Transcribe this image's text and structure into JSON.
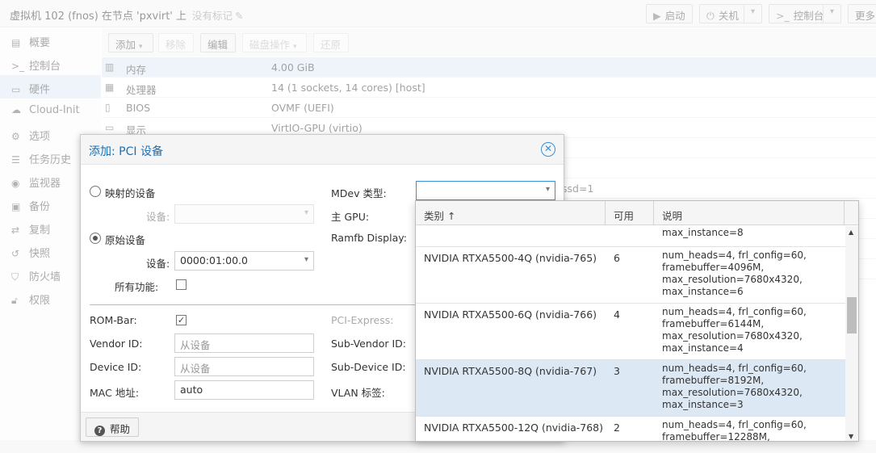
{
  "titlebar": {
    "title": "虚拟机 102 (fnos) 在节点 'pxvirt' 上",
    "no_tags": "没有标记",
    "start": "启动",
    "shutdown": "关机",
    "console": "控制台",
    "more": "更多"
  },
  "sidebar": {
    "items": [
      {
        "icon": "book-icon",
        "label": "概要"
      },
      {
        "icon": "terminal-icon",
        "label": "控制台"
      },
      {
        "icon": "desktop-icon",
        "label": "硬件"
      },
      {
        "icon": "cloud-icon",
        "label": "Cloud-Init"
      },
      {
        "icon": "gear-icon",
        "label": "选项"
      },
      {
        "icon": "list-icon",
        "label": "任务历史"
      },
      {
        "icon": "eye-icon",
        "label": "监视器"
      },
      {
        "icon": "floppy-icon",
        "label": "备份"
      },
      {
        "icon": "retweet-icon",
        "label": "复制"
      },
      {
        "icon": "history-icon",
        "label": "快照"
      },
      {
        "icon": "shield-icon",
        "label": "防火墙"
      },
      {
        "icon": "unlock-icon",
        "label": "权限"
      }
    ]
  },
  "hw_toolbar": {
    "add": "添加",
    "remove": "移除",
    "edit": "编辑",
    "disk_action": "磁盘操作",
    "revert": "还原"
  },
  "hardware": {
    "rows": [
      {
        "key": "内存",
        "value": "4.00 GiB"
      },
      {
        "key": "处理器",
        "value": "14 (1 sockets, 14 cores) [host]"
      },
      {
        "key": "BIOS",
        "value": "OVMF (UEFI)"
      },
      {
        "key": "显示",
        "value": "VirtIO-GPU (virtio)"
      }
    ],
    "partial_text": "ssd=1"
  },
  "dialog": {
    "title": "添加: PCI 设备",
    "mapped_device": "映射的设备",
    "device_label": "设备:",
    "raw_device": "原始设备",
    "raw_device_value": "0000:01:00.0",
    "all_functions": "所有功能:",
    "mdev_type": "MDev 类型:",
    "primary_gpu": "主 GPU:",
    "ramfb_display": "Ramfb Display:",
    "rom_bar": "ROM-Bar:",
    "pci_express": "PCI-Express:",
    "vendor_id": "Vendor ID:",
    "vendor_id_placeholder": "从设备",
    "sub_vendor_id": "Sub-Vendor ID:",
    "device_id": "Device ID:",
    "device_id_placeholder": "从设备",
    "sub_device_id": "Sub-Device ID:",
    "mac_address": "MAC 地址:",
    "mac_value": "auto",
    "vlan_tag": "VLAN 标签:",
    "help": "帮助"
  },
  "mdev_grid": {
    "columns": [
      "类别 ↑",
      "可用",
      "说明"
    ],
    "partial_top": "max_instance=8",
    "rows": [
      {
        "type": "NVIDIA RTXA5500-4Q (nvidia-765)",
        "available": "6",
        "desc": [
          "num_heads=4, frl_config=60,",
          "framebuffer=4096M,",
          "max_resolution=7680x4320,",
          "max_instance=6"
        ],
        "selected": false
      },
      {
        "type": "NVIDIA RTXA5500-6Q (nvidia-766)",
        "available": "4",
        "desc": [
          "num_heads=4, frl_config=60,",
          "framebuffer=6144M,",
          "max_resolution=7680x4320,",
          "max_instance=4"
        ],
        "selected": false
      },
      {
        "type": "NVIDIA RTXA5500-8Q (nvidia-767)",
        "available": "3",
        "desc": [
          "num_heads=4, frl_config=60,",
          "framebuffer=8192M,",
          "max_resolution=7680x4320,",
          "max_instance=3"
        ],
        "selected": true
      },
      {
        "type": "NVIDIA RTXA5500-12Q (nvidia-768)",
        "available": "2",
        "desc": [
          "num_heads=4, frl_config=60,",
          "framebuffer=12288M,",
          "",
          ""
        ],
        "selected": false
      }
    ]
  }
}
